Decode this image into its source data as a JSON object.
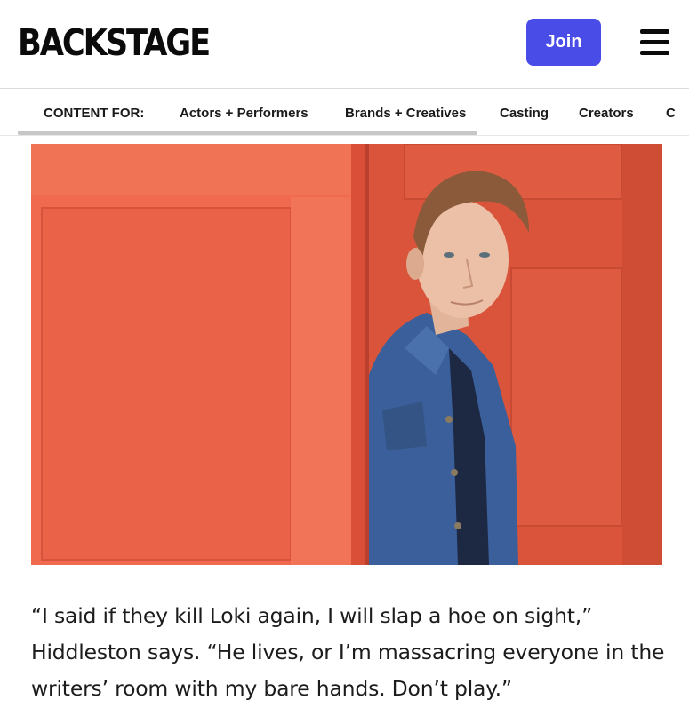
{
  "header": {
    "logo_text": "BACKSTAGE",
    "join_label": "Join",
    "accent_color": "#4a4ce8"
  },
  "subnav": {
    "label": "CONTENT FOR:",
    "items": [
      {
        "label": "Actors + Performers"
      },
      {
        "label": "Brands + Creatives"
      },
      {
        "label": "Casting"
      },
      {
        "label": "Creators"
      },
      {
        "label": "C"
      }
    ]
  },
  "article": {
    "hero_colors": {
      "background": "#e45d46",
      "jacket": "#3a5f9a"
    },
    "caption": "“I said if they kill Loki again, I will slap a hoe on sight,” Hiddleston says. “He lives, or I’m massacring everyone in the writers’ room with my bare hands. Don’t play.”"
  },
  "icons": {
    "menu": "hamburger-menu-icon"
  }
}
